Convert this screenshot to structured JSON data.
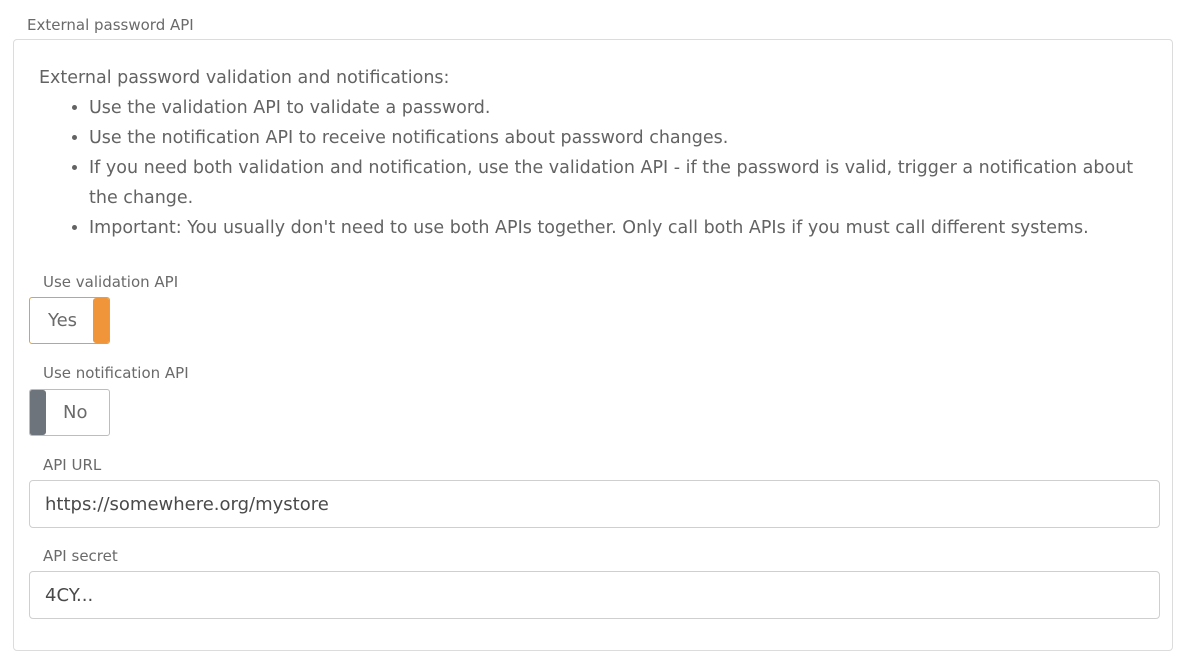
{
  "section": {
    "legend": "External password API"
  },
  "intro": {
    "heading": "External password validation and notifications:",
    "bullets": [
      "Use the validation API to validate a password.",
      "Use the notification API to receive notifications about password changes.",
      "If you need both validation and notification, use the validation API - if the password is valid, trigger a notification about the change.",
      "Important: You usually don't need to use both APIs together. Only call both APIs if you must call different systems."
    ]
  },
  "validation_api": {
    "label": "Use validation API",
    "state_text": "Yes",
    "enabled": true,
    "accent_color": "#f0953a"
  },
  "notification_api": {
    "label": "Use notification API",
    "state_text": "No",
    "enabled": false,
    "off_color": "#6d747b"
  },
  "api_url": {
    "label": "API URL",
    "value": "https://somewhere.org/mystore"
  },
  "api_secret": {
    "label": "API secret",
    "value": "4CY..."
  }
}
